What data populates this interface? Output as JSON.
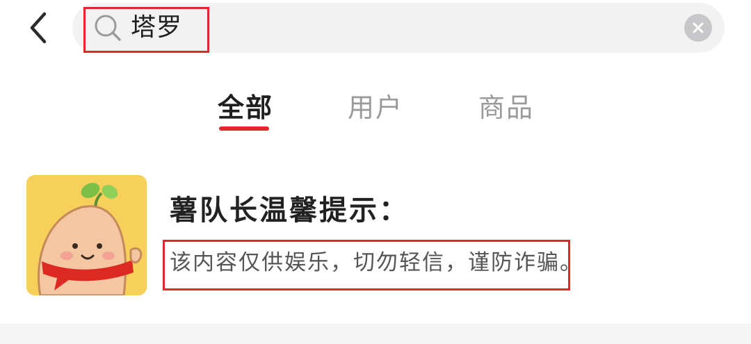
{
  "header": {
    "back_icon": "chevron-left-icon",
    "search": {
      "query": "塔罗",
      "icon": "search-icon",
      "clear_icon": "close-icon"
    }
  },
  "tabs": [
    {
      "label": "全部",
      "active": true
    },
    {
      "label": "用户",
      "active": false
    },
    {
      "label": "商品",
      "active": false
    }
  ],
  "notice": {
    "avatar": "sweet-potato-mascot",
    "title": "薯队长温馨提示：",
    "description": "该内容仅供娱乐，切勿轻信，谨防诈骗。"
  },
  "colors": {
    "accent": "#e3262b",
    "search_bg": "#f2f2f3",
    "avatar_bg": "#f7cf5b"
  }
}
